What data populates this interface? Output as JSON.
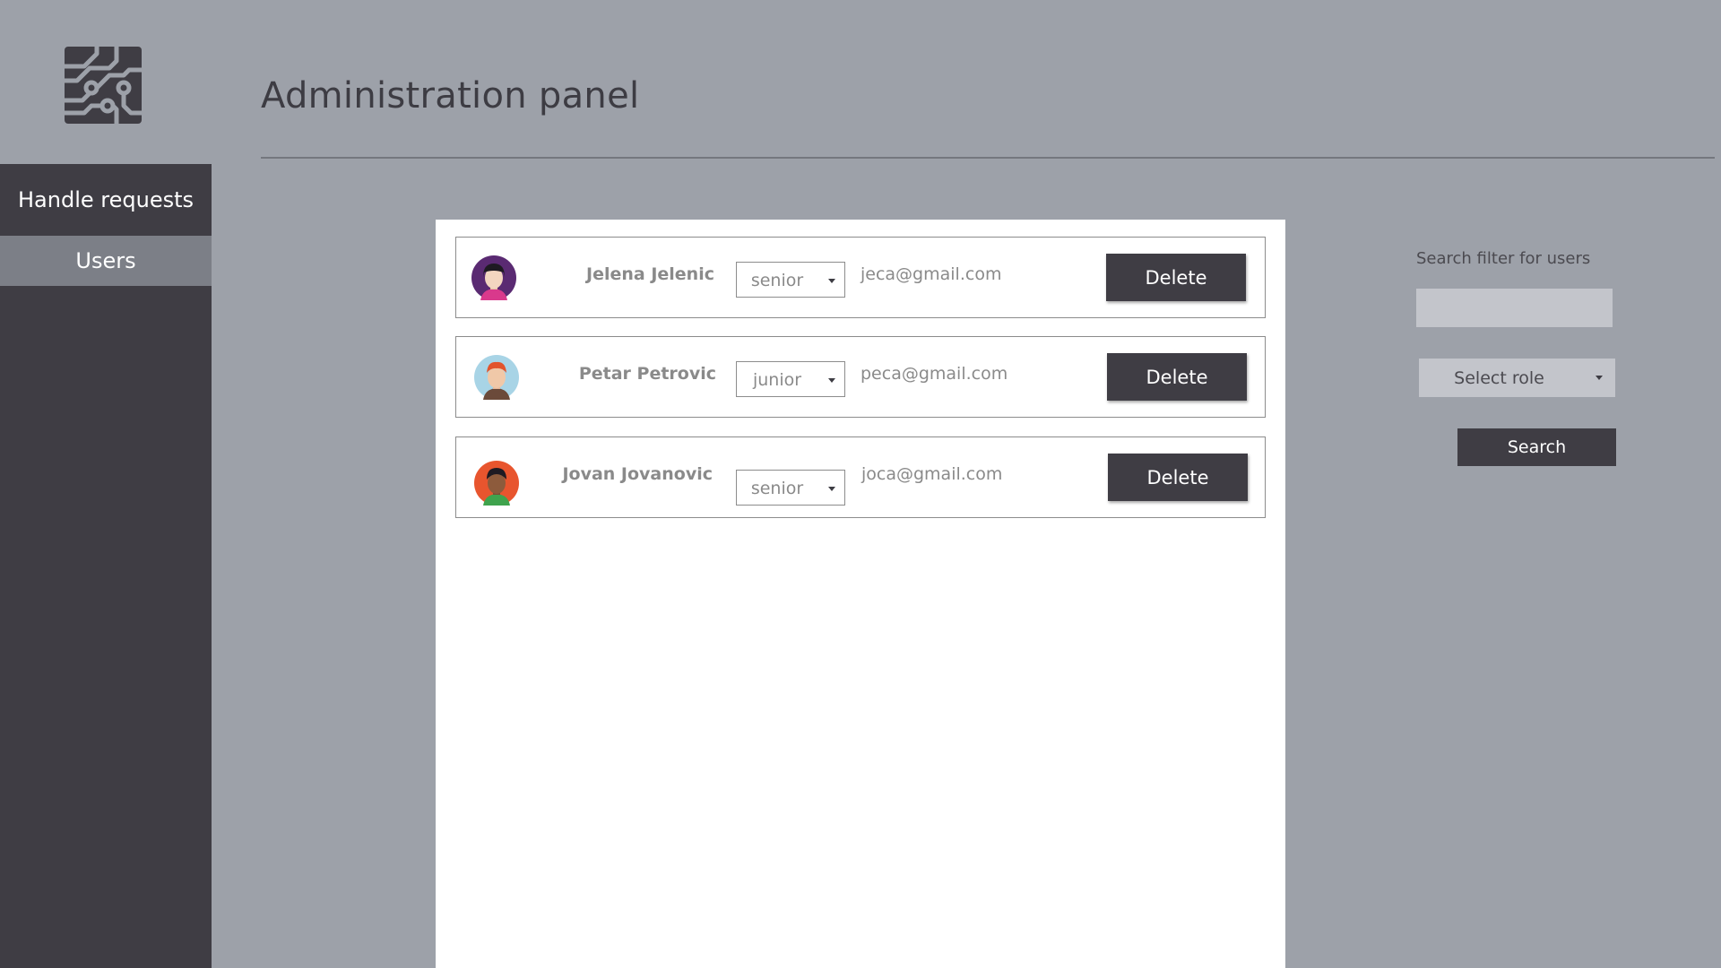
{
  "header": {
    "title": "Administration panel",
    "logo_icon": "circuit-board-logo"
  },
  "sidebar": {
    "items": [
      {
        "label": "Handle requests",
        "active": false
      },
      {
        "label": "Users",
        "active": true
      }
    ]
  },
  "users": [
    {
      "name": "Jelena Jelenic",
      "role": "senior",
      "email": "jeca@gmail.com",
      "delete_label": "Delete",
      "avatar_icon": "woman-avatar-icon"
    },
    {
      "name": "Petar Petrovic",
      "role": "junior",
      "email": "peca@gmail.com",
      "delete_label": "Delete",
      "avatar_icon": "red-haired-man-avatar-icon"
    },
    {
      "name": "Jovan Jovanovic",
      "role": "senior",
      "email": "joca@gmail.com",
      "delete_label": "Delete",
      "avatar_icon": "man-avatar-icon"
    }
  ],
  "filter": {
    "label": "Search filter for users",
    "search_value": "",
    "search_placeholder": "",
    "role_select_label": "Select role",
    "search_button_label": "Search"
  },
  "colors": {
    "background": "#9da1a9",
    "sidebar": "#3f3d44",
    "sidebar_active": "#7c7f87",
    "button": "#3f3d44",
    "panel": "#ffffff",
    "input": "#c3c5cb"
  }
}
